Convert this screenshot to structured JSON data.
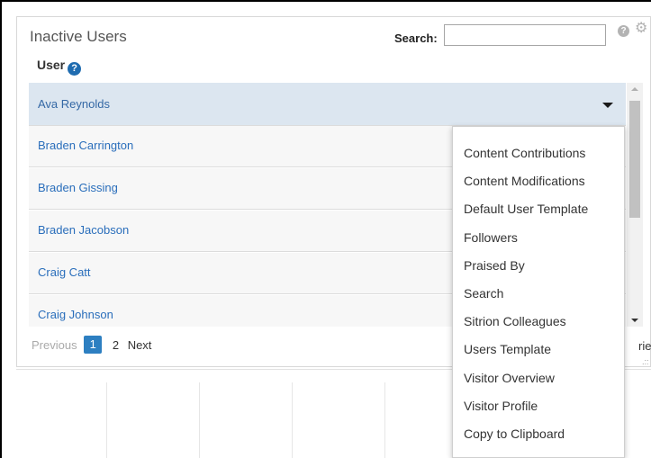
{
  "panel": {
    "title": "Inactive Users",
    "search_label": "Search:",
    "search_value": "",
    "search_placeholder": "",
    "column_header": "User"
  },
  "users": [
    {
      "name": "Ava Reynolds"
    },
    {
      "name": "Braden Carrington"
    },
    {
      "name": "Braden Gissing"
    },
    {
      "name": "Braden Jacobson"
    },
    {
      "name": "Craig Catt"
    },
    {
      "name": "Craig Johnson"
    }
  ],
  "pagination": {
    "previous": "Previous",
    "pages": [
      "1",
      "2"
    ],
    "current": "1",
    "next": "Next",
    "entries_tail": "ries"
  },
  "context_menu": {
    "items": [
      "Content Contributions",
      "Content Modifications",
      "Default User Template",
      "Followers",
      "Praised By",
      "Search",
      "Sitrion Colleagues",
      "Users Template",
      "Visitor Overview",
      "Visitor Profile",
      "Copy to Clipboard"
    ]
  },
  "colors": {
    "selected_row": "#dce6f0",
    "link": "#2a6ebb",
    "page_active": "#2d7fc1",
    "help_icon": "#1f6cb0"
  },
  "icons": {
    "help": "help-icon",
    "settings": "gear-icon",
    "dropdown": "chevron-down-icon"
  }
}
